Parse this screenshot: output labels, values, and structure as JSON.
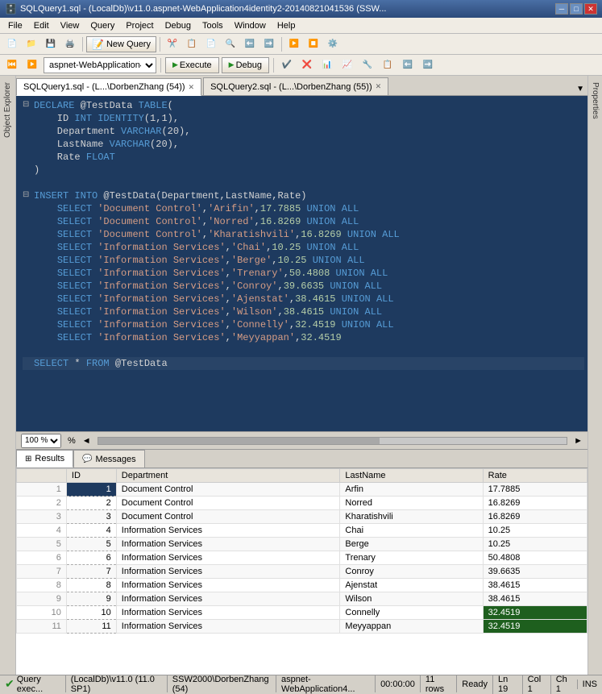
{
  "titleBar": {
    "title": "SQLQuery1.sql - (LocalDb)\\v11.0.aspnet-WebApplication4identity2-20140821041536 (SSW...",
    "minimizeLabel": "─",
    "maximizeLabel": "□",
    "closeLabel": "✕"
  },
  "menuBar": {
    "items": [
      "File",
      "Edit",
      "View",
      "Query",
      "Project",
      "Debug",
      "Tools",
      "Window",
      "Help"
    ]
  },
  "toolbar": {
    "newQueryLabel": "New Query"
  },
  "toolbar2": {
    "dbValue": "aspnet-WebApplication4ide...",
    "executeLabel": "Execute",
    "debugLabel": "Debug"
  },
  "tabs": [
    {
      "label": "SQLQuery1.sql - (L...\\DorbenZhang (54))",
      "active": true
    },
    {
      "label": "SQLQuery2.sql - (L...\\DorbenZhang (55))",
      "active": false
    }
  ],
  "sqlCode": [
    {
      "fold": "⊟",
      "line": "DECLARE @TestData TABLE(",
      "parts": [
        {
          "t": "kw",
          "v": "DECLARE"
        },
        {
          "t": "plain",
          "v": " @TestData "
        },
        {
          "t": "kw",
          "v": "TABLE"
        },
        {
          "t": "plain",
          "v": "("
        }
      ]
    },
    {
      "fold": "",
      "line": "    ID INT IDENTITY(1,1),",
      "parts": [
        {
          "t": "plain",
          "v": "    ID "
        },
        {
          "t": "kw",
          "v": "INT"
        },
        {
          "t": "plain",
          "v": " "
        },
        {
          "t": "kw",
          "v": "IDENTITY"
        },
        {
          "t": "plain",
          "v": "(1,1),"
        }
      ]
    },
    {
      "fold": "",
      "line": "    Department VARCHAR(20),",
      "parts": [
        {
          "t": "plain",
          "v": "    Department "
        },
        {
          "t": "kw",
          "v": "VARCHAR"
        },
        {
          "t": "plain",
          "v": "(20),"
        }
      ]
    },
    {
      "fold": "",
      "line": "    LastName VARCHAR(20),",
      "parts": [
        {
          "t": "plain",
          "v": "    LastName "
        },
        {
          "t": "kw",
          "v": "VARCHAR"
        },
        {
          "t": "plain",
          "v": "(20),"
        }
      ]
    },
    {
      "fold": "",
      "line": "    Rate FLOAT",
      "parts": [
        {
          "t": "plain",
          "v": "    Rate "
        },
        {
          "t": "kw",
          "v": "FLOAT"
        }
      ]
    },
    {
      "fold": "",
      "line": ")",
      "parts": [
        {
          "t": "plain",
          "v": ")"
        }
      ]
    },
    {
      "fold": "",
      "line": "",
      "parts": []
    },
    {
      "fold": "⊟",
      "line": "INSERT INTO @TestData(Department,LastName,Rate)",
      "parts": [
        {
          "t": "kw",
          "v": "INSERT"
        },
        {
          "t": "plain",
          "v": " "
        },
        {
          "t": "kw",
          "v": "INTO"
        },
        {
          "t": "plain",
          "v": " @TestData(Department,LastName,Rate)"
        }
      ]
    },
    {
      "fold": "",
      "line": "    SELECT 'Document Control','Arifin',17.7885 UNION ALL",
      "parts": [
        {
          "t": "plain",
          "v": "    "
        },
        {
          "t": "kw",
          "v": "SELECT"
        },
        {
          "t": "plain",
          "v": " "
        },
        {
          "t": "str",
          "v": "'Document Control'"
        },
        {
          "t": "plain",
          "v": ","
        },
        {
          "t": "str",
          "v": "'Arifin'"
        },
        {
          "t": "plain",
          "v": ","
        },
        {
          "t": "num",
          "v": "17.7885"
        },
        {
          "t": "plain",
          "v": " "
        },
        {
          "t": "kw",
          "v": "UNION"
        },
        {
          "t": "plain",
          "v": " "
        },
        {
          "t": "kw",
          "v": "ALL"
        }
      ]
    },
    {
      "fold": "",
      "line": "    SELECT 'Document Control','Norred',16.8269 UNION ALL",
      "parts": [
        {
          "t": "plain",
          "v": "    "
        },
        {
          "t": "kw",
          "v": "SELECT"
        },
        {
          "t": "plain",
          "v": " "
        },
        {
          "t": "str",
          "v": "'Document Control'"
        },
        {
          "t": "plain",
          "v": ","
        },
        {
          "t": "str",
          "v": "'Norred'"
        },
        {
          "t": "plain",
          "v": ","
        },
        {
          "t": "num",
          "v": "16.8269"
        },
        {
          "t": "plain",
          "v": " "
        },
        {
          "t": "kw",
          "v": "UNION"
        },
        {
          "t": "plain",
          "v": " "
        },
        {
          "t": "kw",
          "v": "ALL"
        }
      ]
    },
    {
      "fold": "",
      "line": "    SELECT 'Document Control','Kharatishvili',16.8269 UNION ALL",
      "parts": [
        {
          "t": "plain",
          "v": "    "
        },
        {
          "t": "kw",
          "v": "SELECT"
        },
        {
          "t": "plain",
          "v": " "
        },
        {
          "t": "str",
          "v": "'Document Control'"
        },
        {
          "t": "plain",
          "v": ","
        },
        {
          "t": "str",
          "v": "'Kharatishvili'"
        },
        {
          "t": "plain",
          "v": ","
        },
        {
          "t": "num",
          "v": "16.8269"
        },
        {
          "t": "plain",
          "v": " "
        },
        {
          "t": "kw",
          "v": "UNION"
        },
        {
          "t": "plain",
          "v": " "
        },
        {
          "t": "kw",
          "v": "ALL"
        }
      ]
    },
    {
      "fold": "",
      "line": "    SELECT 'Information Services','Chai',10.25 UNION ALL",
      "parts": [
        {
          "t": "plain",
          "v": "    "
        },
        {
          "t": "kw",
          "v": "SELECT"
        },
        {
          "t": "plain",
          "v": " "
        },
        {
          "t": "str",
          "v": "'Information Services'"
        },
        {
          "t": "plain",
          "v": ","
        },
        {
          "t": "str",
          "v": "'Chai'"
        },
        {
          "t": "plain",
          "v": ","
        },
        {
          "t": "num",
          "v": "10.25"
        },
        {
          "t": "plain",
          "v": " "
        },
        {
          "t": "kw",
          "v": "UNION"
        },
        {
          "t": "plain",
          "v": " "
        },
        {
          "t": "kw",
          "v": "ALL"
        }
      ]
    },
    {
      "fold": "",
      "line": "    SELECT 'Information Services','Berge',10.25 UNION ALL",
      "parts": [
        {
          "t": "plain",
          "v": "    "
        },
        {
          "t": "kw",
          "v": "SELECT"
        },
        {
          "t": "plain",
          "v": " "
        },
        {
          "t": "str",
          "v": "'Information Services'"
        },
        {
          "t": "plain",
          "v": ","
        },
        {
          "t": "str",
          "v": "'Berge'"
        },
        {
          "t": "plain",
          "v": ","
        },
        {
          "t": "num",
          "v": "10.25"
        },
        {
          "t": "plain",
          "v": " "
        },
        {
          "t": "kw",
          "v": "UNION"
        },
        {
          "t": "plain",
          "v": " "
        },
        {
          "t": "kw",
          "v": "ALL"
        }
      ]
    },
    {
      "fold": "",
      "line": "    SELECT 'Information Services','Trenary',50.4808 UNION ALL",
      "parts": [
        {
          "t": "plain",
          "v": "    "
        },
        {
          "t": "kw",
          "v": "SELECT"
        },
        {
          "t": "plain",
          "v": " "
        },
        {
          "t": "str",
          "v": "'Information Services'"
        },
        {
          "t": "plain",
          "v": ","
        },
        {
          "t": "str",
          "v": "'Trenary'"
        },
        {
          "t": "plain",
          "v": ","
        },
        {
          "t": "num",
          "v": "50.4808"
        },
        {
          "t": "plain",
          "v": " "
        },
        {
          "t": "kw",
          "v": "UNION"
        },
        {
          "t": "plain",
          "v": " "
        },
        {
          "t": "kw",
          "v": "ALL"
        }
      ]
    },
    {
      "fold": "",
      "line": "    SELECT 'Information Services','Conroy',39.6635 UNION ALL",
      "parts": [
        {
          "t": "plain",
          "v": "    "
        },
        {
          "t": "kw",
          "v": "SELECT"
        },
        {
          "t": "plain",
          "v": " "
        },
        {
          "t": "str",
          "v": "'Information Services'"
        },
        {
          "t": "plain",
          "v": ","
        },
        {
          "t": "str",
          "v": "'Conroy'"
        },
        {
          "t": "plain",
          "v": ","
        },
        {
          "t": "num",
          "v": "39.6635"
        },
        {
          "t": "plain",
          "v": " "
        },
        {
          "t": "kw",
          "v": "UNION"
        },
        {
          "t": "plain",
          "v": " "
        },
        {
          "t": "kw",
          "v": "ALL"
        }
      ]
    },
    {
      "fold": "",
      "line": "    SELECT 'Information Services','Ajenstat',38.4615 UNION ALL",
      "parts": [
        {
          "t": "plain",
          "v": "    "
        },
        {
          "t": "kw",
          "v": "SELECT"
        },
        {
          "t": "plain",
          "v": " "
        },
        {
          "t": "str",
          "v": "'Information Services'"
        },
        {
          "t": "plain",
          "v": ","
        },
        {
          "t": "str",
          "v": "'Ajenstat'"
        },
        {
          "t": "plain",
          "v": ","
        },
        {
          "t": "num",
          "v": "38.4615"
        },
        {
          "t": "plain",
          "v": " "
        },
        {
          "t": "kw",
          "v": "UNION"
        },
        {
          "t": "plain",
          "v": " "
        },
        {
          "t": "kw",
          "v": "ALL"
        }
      ]
    },
    {
      "fold": "",
      "line": "    SELECT 'Information Services','Wilson',38.4615 UNION ALL",
      "parts": [
        {
          "t": "plain",
          "v": "    "
        },
        {
          "t": "kw",
          "v": "SELECT"
        },
        {
          "t": "plain",
          "v": " "
        },
        {
          "t": "str",
          "v": "'Information Services'"
        },
        {
          "t": "plain",
          "v": ","
        },
        {
          "t": "str",
          "v": "'Wilson'"
        },
        {
          "t": "plain",
          "v": ","
        },
        {
          "t": "num",
          "v": "38.4615"
        },
        {
          "t": "plain",
          "v": " "
        },
        {
          "t": "kw",
          "v": "UNION"
        },
        {
          "t": "plain",
          "v": " "
        },
        {
          "t": "kw",
          "v": "ALL"
        }
      ]
    },
    {
      "fold": "",
      "line": "    SELECT 'Information Services','Connelly',32.4519 UNION ALL",
      "parts": [
        {
          "t": "plain",
          "v": "    "
        },
        {
          "t": "kw",
          "v": "SELECT"
        },
        {
          "t": "plain",
          "v": " "
        },
        {
          "t": "str",
          "v": "'Information Services'"
        },
        {
          "t": "plain",
          "v": ","
        },
        {
          "t": "str",
          "v": "'Connelly'"
        },
        {
          "t": "plain",
          "v": ","
        },
        {
          "t": "num",
          "v": "32.4519"
        },
        {
          "t": "plain",
          "v": " "
        },
        {
          "t": "kw",
          "v": "UNION"
        },
        {
          "t": "plain",
          "v": " "
        },
        {
          "t": "kw",
          "v": "ALL"
        }
      ]
    },
    {
      "fold": "",
      "line": "    SELECT 'Information Services','Meyyappan',32.4519",
      "parts": [
        {
          "t": "plain",
          "v": "    "
        },
        {
          "t": "kw",
          "v": "SELECT"
        },
        {
          "t": "plain",
          "v": " "
        },
        {
          "t": "str",
          "v": "'Information Services'"
        },
        {
          "t": "plain",
          "v": ","
        },
        {
          "t": "str",
          "v": "'Meyyappan'"
        },
        {
          "t": "plain",
          "v": ","
        },
        {
          "t": "num",
          "v": "32.4519"
        }
      ]
    },
    {
      "fold": "",
      "line": "",
      "parts": []
    },
    {
      "fold": "",
      "line": "SELECT * FROM @TestData",
      "parts": [
        {
          "t": "kw",
          "v": "SELECT"
        },
        {
          "t": "plain",
          "v": " * "
        },
        {
          "t": "kw",
          "v": "FROM"
        },
        {
          "t": "plain",
          "v": " @TestData"
        }
      ]
    }
  ],
  "editorStatus": {
    "zoom": "100 %"
  },
  "resultsTabs": [
    {
      "label": "Results",
      "active": true,
      "icon": "grid"
    },
    {
      "label": "Messages",
      "active": false,
      "icon": "msg"
    }
  ],
  "resultsTable": {
    "columns": [
      "",
      "ID",
      "Department",
      "LastName",
      "Rate"
    ],
    "rows": [
      {
        "rowNum": "1",
        "id": "1",
        "department": "Document Control",
        "lastName": "Arfin",
        "rate": "17.7885",
        "idHighlight": true
      },
      {
        "rowNum": "2",
        "id": "2",
        "department": "Document Control",
        "lastName": "Norred",
        "rate": "16.8269"
      },
      {
        "rowNum": "3",
        "id": "3",
        "department": "Document Control",
        "lastName": "Kharatishvili",
        "rate": "16.8269"
      },
      {
        "rowNum": "4",
        "id": "4",
        "department": "Information Services",
        "lastName": "Chai",
        "rate": "10.25"
      },
      {
        "rowNum": "5",
        "id": "5",
        "department": "Information Services",
        "lastName": "Berge",
        "rate": "10.25"
      },
      {
        "rowNum": "6",
        "id": "6",
        "department": "Information Services",
        "lastName": "Trenary",
        "rate": "50.4808"
      },
      {
        "rowNum": "7",
        "id": "7",
        "department": "Information Services",
        "lastName": "Conroy",
        "rate": "39.6635"
      },
      {
        "rowNum": "8",
        "id": "8",
        "department": "Information Services",
        "lastName": "Ajenstat",
        "rate": "38.4615"
      },
      {
        "rowNum": "9",
        "id": "9",
        "department": "Information Services",
        "lastName": "Wilson",
        "rate": "38.4615"
      },
      {
        "rowNum": "10",
        "id": "10",
        "department": "Information Services",
        "lastName": "Connelly",
        "rate": "32.4519",
        "numHighlight": true
      },
      {
        "rowNum": "11",
        "id": "11",
        "department": "Information Services",
        "lastName": "Meyyappan",
        "rate": "32.4519",
        "numHighlight": true
      }
    ]
  },
  "statusBar": {
    "queryExec": "Query exec...",
    "localDb": "(LocalDb)\\v11.0 (11.0 SP1)",
    "server": "SSW2000\\DorbenZhang (54)",
    "db": "aspnet-WebApplication4...",
    "time": "00:00:00",
    "rows": "11 rows",
    "ready": "Ready",
    "ln": "Ln 19",
    "col": "Col 1",
    "ch": "Ch 1",
    "ins": "INS"
  }
}
